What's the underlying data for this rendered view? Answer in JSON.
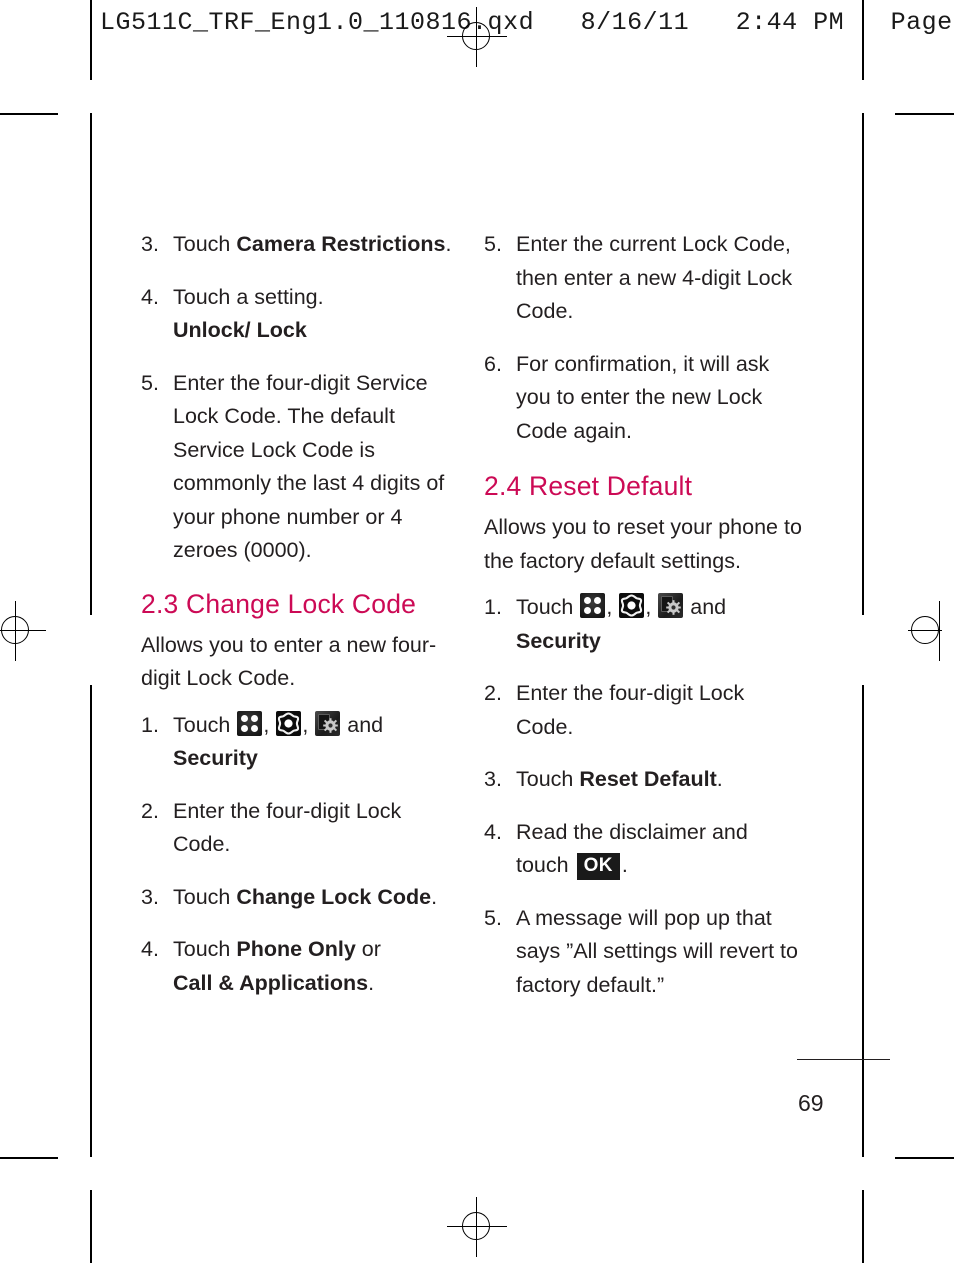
{
  "print_slug": "LG511C_TRF_Eng1.0_110816.qxd   8/16/11   2:44 PM   Page 69",
  "folio": "69",
  "theme": {
    "heading_color": "#cc0a55",
    "body_color": "#231f20",
    "icon_background": "#1c1c1c",
    "okkey_background": "#1a1a1a"
  },
  "left_column": {
    "items": [
      {
        "num": "3.",
        "lead": "Touch ",
        "bold": "Camera Restrictions",
        "tail": "."
      },
      {
        "num": "4.",
        "lead": "Touch a setting.",
        "sub_bold": "Unlock/ Lock"
      },
      {
        "num": "5.",
        "lead": "Enter the four-digit Service Lock Code. The default Service Lock Code is commonly the last 4 digits of your phone number or 4 zeroes (0000)."
      }
    ],
    "section": {
      "heading": "2.3 Change Lock Code",
      "intro": "Allows you to enter a new four-digit Lock Code.",
      "steps": [
        {
          "num": "1.",
          "lead": "Touch ",
          "icons": [
            "menu-grid-icon",
            "settings-gear-icon",
            "phone-settings-icon"
          ],
          "mid": " and ",
          "bold": "Security",
          "tail": "."
        },
        {
          "num": "2.",
          "lead": "Enter the four-digit Lock Code."
        },
        {
          "num": "3.",
          "lead": "Touch ",
          "bold": "Change Lock Code",
          "tail": "."
        },
        {
          "num": "4.",
          "lead": "Touch ",
          "bold": "Phone Only",
          "mid": " or ",
          "bold2": "Call & Applications",
          "tail": "."
        }
      ]
    }
  },
  "right_column": {
    "items": [
      {
        "num": "5.",
        "lead": "Enter the current Lock Code, then enter a new 4-digit Lock Code."
      },
      {
        "num": "6.",
        "lead": "For confirmation, it will ask you to enter the new Lock Code again."
      }
    ],
    "section": {
      "heading": "2.4 Reset Default",
      "intro": "Allows you to reset your phone to the factory default settings.",
      "steps": [
        {
          "num": "1.",
          "lead": "Touch ",
          "icons": [
            "menu-grid-icon",
            "settings-gear-icon",
            "phone-settings-icon"
          ],
          "mid": " and ",
          "bold": "Security",
          "tail": "."
        },
        {
          "num": "2.",
          "lead": "Enter the four-digit Lock Code."
        },
        {
          "num": "3.",
          "lead": "Touch ",
          "bold": "Reset Default",
          "tail": "."
        },
        {
          "num": "4.",
          "lead": "Read the disclaimer and touch ",
          "key": "OK",
          "tail": "."
        },
        {
          "num": "5.",
          "lead": "A message will pop up that says ”All settings will revert to factory default.”"
        }
      ]
    }
  }
}
